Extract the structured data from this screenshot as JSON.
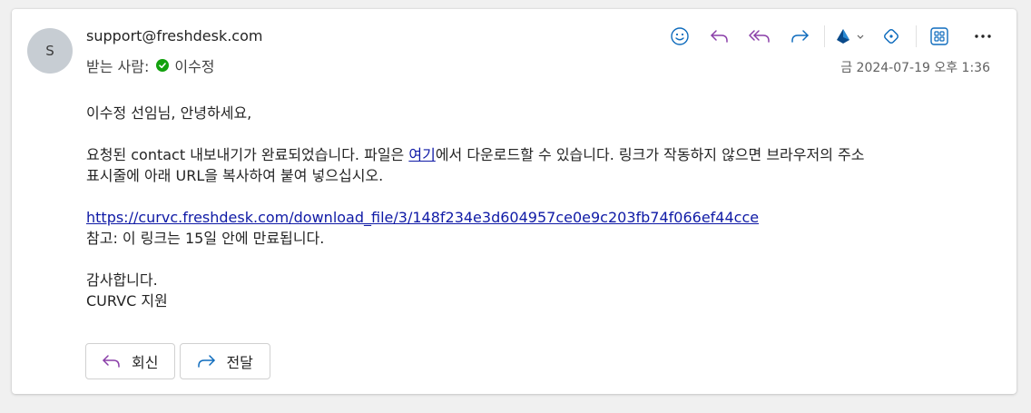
{
  "sender": {
    "initial": "S",
    "address": "support@freshdesk.com",
    "to_label": "받는 사람:",
    "recipient": "이수정",
    "date": "금 2024-07-19 오후 1:36"
  },
  "toolbar": {
    "icons": [
      "emoji-icon",
      "reply-icon",
      "reply-all-icon",
      "forward-icon",
      "app-icon",
      "tag-icon",
      "apps-icon",
      "more-icon"
    ]
  },
  "message": {
    "greeting": "이수정 선임님, 안녕하세요,",
    "line1_before": "요청된 contact 내보내기가 완료되었습니다. 파일은 ",
    "line1_link": "여기",
    "line1_after": "에서 다운로드할 수 있습니다. 링크가 작동하지 않으면 브라우저의 주소",
    "line2": "표시줄에 아래 URL을 복사하여 붙여 넣으십시오.",
    "url": "https://curvc.freshdesk.com/download_file/3/148f234e3d604957ce0e9c203fb74f066ef44cce",
    "note": "참고: 이 링크는 15일 안에 만료됩니다.",
    "thanks": "감사합니다.",
    "signature": "CURVC 지원"
  },
  "actions": {
    "reply_label": "회신",
    "forward_label": "전달"
  },
  "colors": {
    "accent": "#0f6cbd",
    "reply_purple": "#8a3ea8",
    "check_green": "#13a10e"
  }
}
